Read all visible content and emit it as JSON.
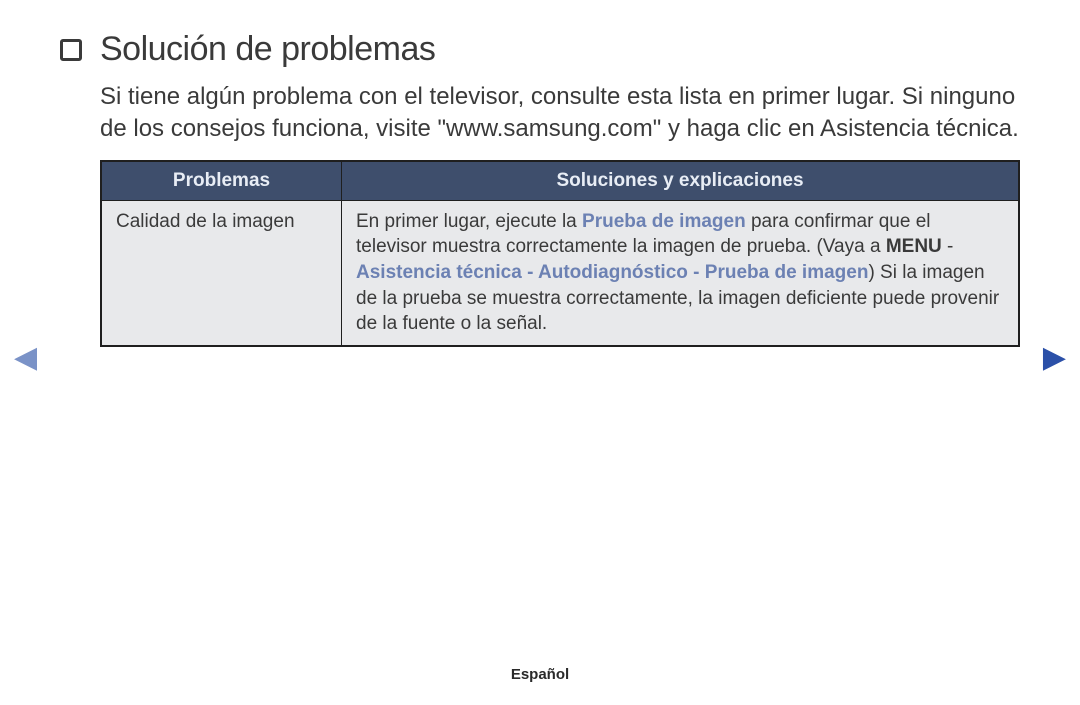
{
  "title": "Solución de problemas",
  "intro": "Si tiene algún problema con el televisor, consulte esta lista en primer lugar. Si ninguno de los consejos funciona, visite \"www.samsung.com\" y haga clic en Asistencia técnica.",
  "table": {
    "headers": {
      "problems": "Problemas",
      "solutions": "Soluciones y explicaciones"
    },
    "row1": {
      "problem": "Calidad de la imagen",
      "sol": {
        "p1a": "En primer lugar, ejecute la ",
        "p1b_link": "Prueba de imagen",
        "p1c": " para confirmar que el televisor muestra correctamente la imagen de prueba. (Vaya a ",
        "p1d_bold": "MENU",
        "p2a": " - ",
        "p2b_link": "Asistencia técnica",
        "p2c": " - ",
        "p2d_link": "Autodiagnóstico",
        "p2e": " - ",
        "p2f_link": "Prueba de imagen",
        "p2g": ") Si la imagen de la prueba se muestra correctamente, la imagen deficiente puede provenir de la fuente o la señal."
      }
    }
  },
  "footer": {
    "language": "Español"
  },
  "nav": {
    "prev": "◀",
    "next": "▶"
  }
}
